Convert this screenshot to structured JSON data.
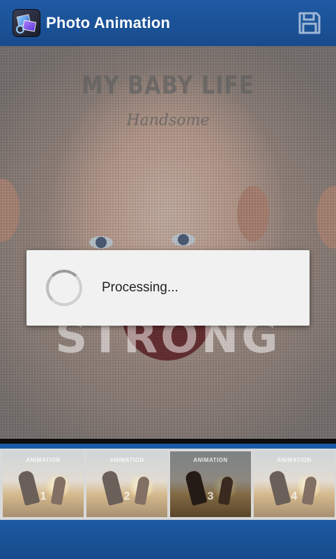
{
  "app_bar": {
    "title": "Photo Animation",
    "icon": "photo-animation-app-icon",
    "save_icon": "floppy-disk-icon"
  },
  "preview": {
    "title": "MY BABY LIFE",
    "subtitle": "Handsome",
    "word": "STRONG"
  },
  "dialog": {
    "message": "Processing...",
    "indicator": "spinner"
  },
  "thumbnails": [
    {
      "label": "ANIMATION",
      "number": "1",
      "selected": false
    },
    {
      "label": "ANIMATION",
      "number": "2",
      "selected": false
    },
    {
      "label": "ANIMATION",
      "number": "3",
      "selected": true
    },
    {
      "label": "ANIMATION",
      "number": "4",
      "selected": false
    }
  ],
  "colors": {
    "accent": "#1f5aa3",
    "dialog_bg": "#f1f1f1"
  }
}
